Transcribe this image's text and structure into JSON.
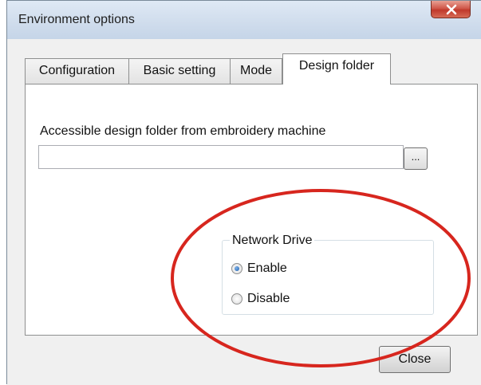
{
  "window": {
    "title": "Environment options"
  },
  "tabs": [
    {
      "label": "Configuration"
    },
    {
      "label": "Basic setting"
    },
    {
      "label": "Mode"
    },
    {
      "label": "Design folder",
      "active": true
    }
  ],
  "design_folder": {
    "label": "Accessible design folder from embroidery machine",
    "path_value": "",
    "browse_label": "..."
  },
  "network_drive": {
    "group_title": "Network Drive",
    "options": [
      {
        "label": "Enable",
        "selected": true
      },
      {
        "label": "Disable",
        "selected": false
      }
    ]
  },
  "footer": {
    "close_label": "Close"
  },
  "annotation": {
    "color": "#d7261e"
  }
}
